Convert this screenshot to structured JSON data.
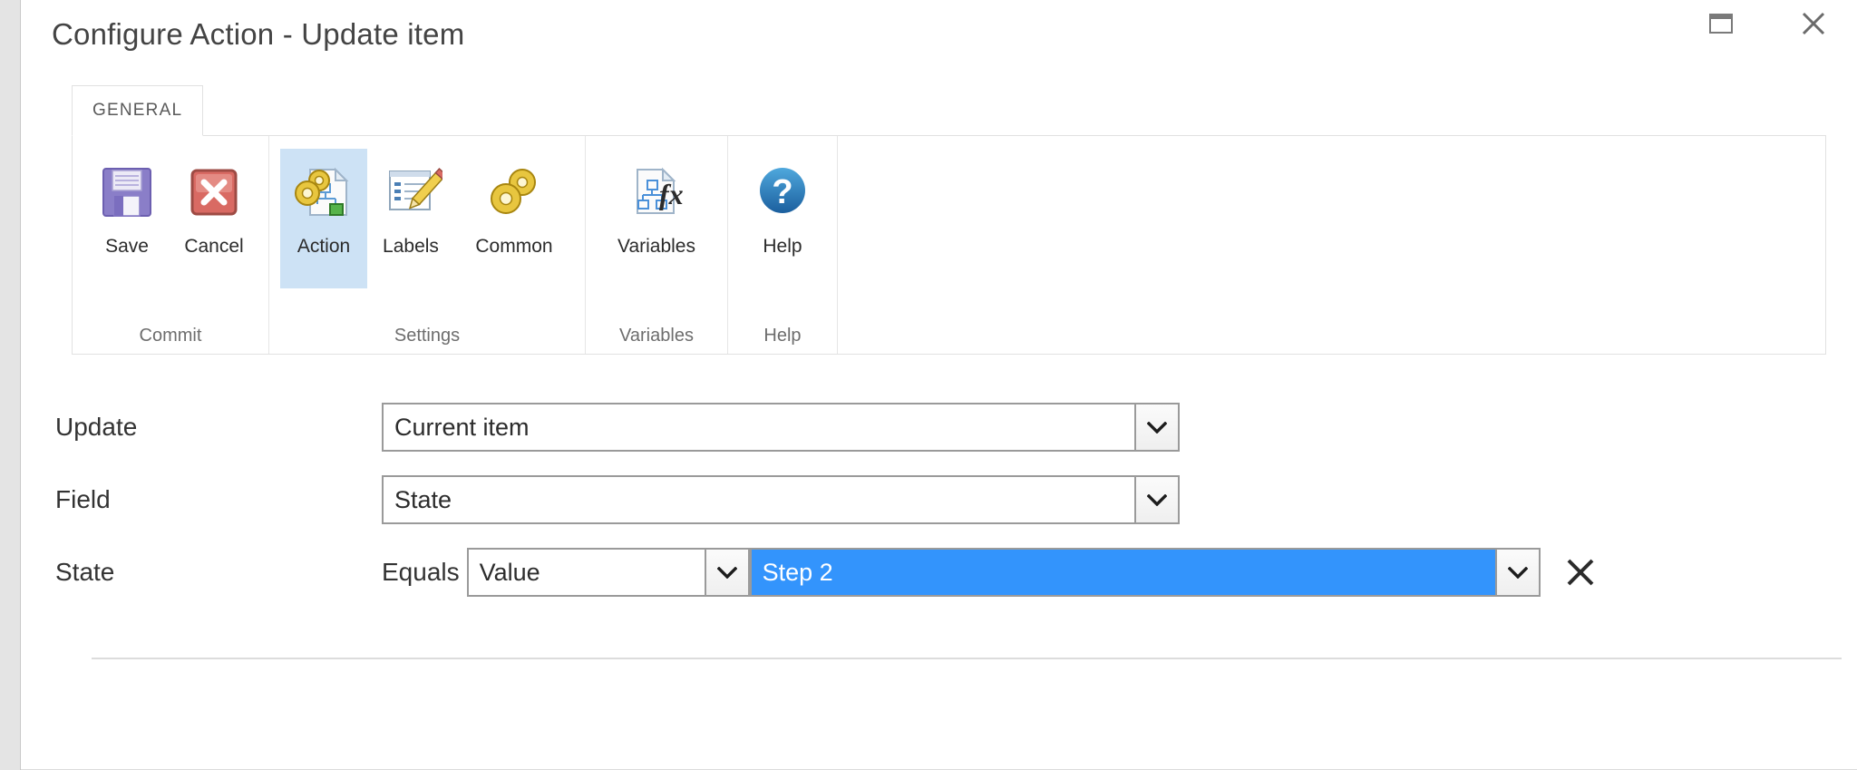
{
  "window": {
    "title": "Configure Action - Update item",
    "controls": [
      {
        "name": "maximize-button",
        "icon": "maximize-icon",
        "label": "Maximize"
      },
      {
        "name": "close-button",
        "icon": "close-icon",
        "label": "Close"
      }
    ]
  },
  "ribbon": {
    "tabs": [
      {
        "label": "GENERAL",
        "active": true
      }
    ],
    "groups": [
      {
        "label": "Commit",
        "items": [
          {
            "label": "Save",
            "icon": "floppy-disk-save-icon",
            "selected": false
          },
          {
            "label": "Cancel",
            "icon": "red-x-cancel-icon",
            "selected": false
          }
        ]
      },
      {
        "label": "Settings",
        "items": [
          {
            "label": "Action",
            "icon": "gears-document-action-icon",
            "selected": true
          },
          {
            "label": "Labels",
            "icon": "list-pencil-labels-icon",
            "selected": false
          },
          {
            "label": "Common",
            "icon": "gears-common-icon",
            "selected": false
          }
        ]
      },
      {
        "label": "Variables",
        "items": [
          {
            "label": "Variables",
            "icon": "document-fx-variables-icon",
            "selected": false
          }
        ]
      },
      {
        "label": "Help",
        "items": [
          {
            "label": "Help",
            "icon": "blue-question-help-icon",
            "selected": false
          }
        ]
      }
    ]
  },
  "form": {
    "rows": {
      "update": {
        "label": "Update",
        "value": "Current item"
      },
      "field": {
        "label": "Field",
        "value": "State"
      },
      "state": {
        "label": "State",
        "operator_text": "Equals",
        "operator_value": "Value",
        "value": "Step 2",
        "remove_label": "Remove"
      }
    }
  },
  "colors": {
    "selection_blue": "#3394fc",
    "ribbon_selected": "#cde2f5",
    "accent_border": "#9a9a9a"
  }
}
